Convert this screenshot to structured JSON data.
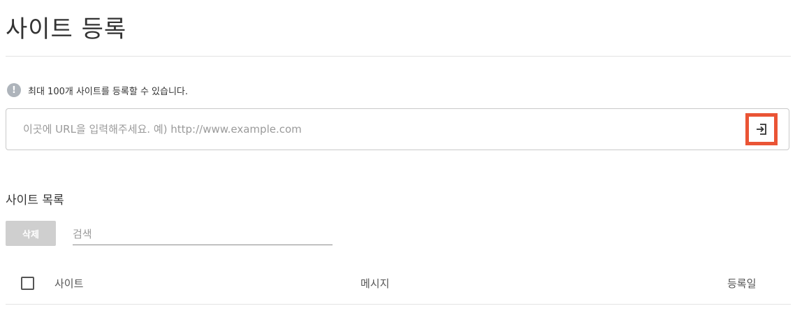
{
  "page": {
    "title": "사이트 등록"
  },
  "notice": {
    "icon": "exclamation-icon",
    "glyph": "!",
    "text": "최대 100개 사이트를 등록할 수 있습니다."
  },
  "url_form": {
    "placeholder": "이곳에 URL을 입력해주세요. 예) http://www.example.com",
    "value": "",
    "submit_icon": "login-arrow-icon",
    "highlight_color": "#ea5435"
  },
  "site_list": {
    "title": "사이트 목록",
    "delete_label": "삭제",
    "search_placeholder": "검색",
    "columns": {
      "site": "사이트",
      "message": "메시지",
      "registered_date": "등록일"
    },
    "rows": []
  }
}
